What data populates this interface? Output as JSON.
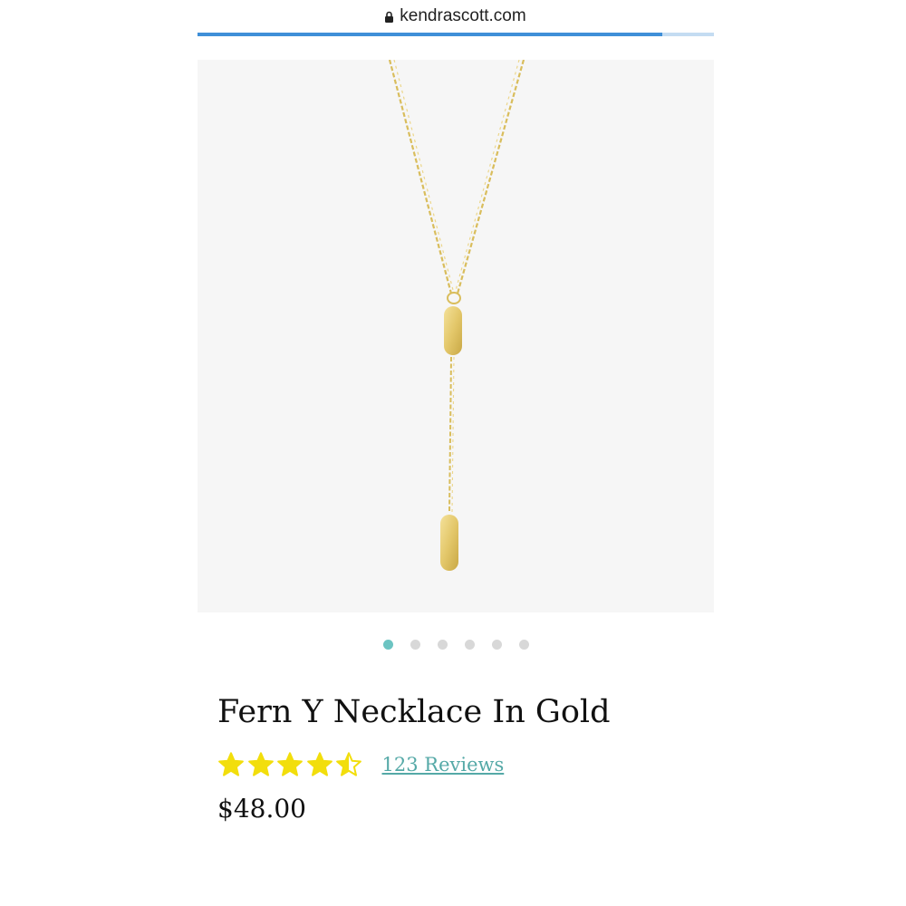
{
  "browser": {
    "url": "kendrascott.com",
    "lock_icon": "lock-icon",
    "load_progress_percent": 90,
    "progress_color": "#3f8fd8"
  },
  "product": {
    "image": {
      "subject": "gold-y-necklace",
      "background_color": "#f6f6f6",
      "metal_color": "#e3c76a"
    },
    "carousel": {
      "total": 6,
      "active_index": 0,
      "active_color": "#6cc4c2",
      "inactive_color": "#d8d8d8"
    },
    "title": "Fern Y Necklace In Gold",
    "rating": {
      "value": 4.5,
      "max": 5,
      "star_color": "#f2de0c",
      "icon": "star-icon"
    },
    "reviews_label": "123 Reviews",
    "price": "$48.00"
  }
}
